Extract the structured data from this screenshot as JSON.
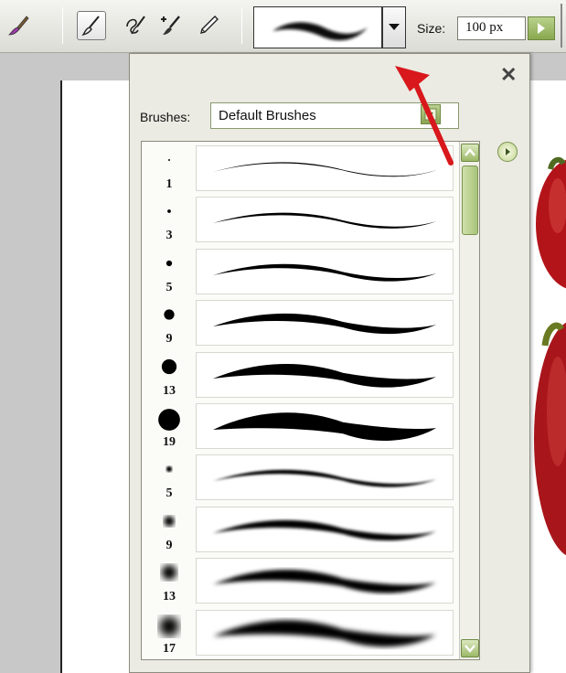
{
  "toolbar": {
    "tools": [
      {
        "icon": "brush-tool-icon",
        "active": false
      },
      {
        "icon": "brush-icon",
        "active": true
      },
      {
        "icon": "impressionist-brush-icon",
        "active": false
      },
      {
        "icon": "color-replacement-icon",
        "active": false
      },
      {
        "icon": "pencil-icon",
        "active": false
      }
    ],
    "size_label": "Size:",
    "size_value": "100 px"
  },
  "brush_picker": {
    "brushes_label": "Brushes:",
    "brush_set": "Default Brushes",
    "brushes": [
      {
        "size": "1",
        "hardness": "hard"
      },
      {
        "size": "3",
        "hardness": "hard"
      },
      {
        "size": "5",
        "hardness": "hard"
      },
      {
        "size": "9",
        "hardness": "hard"
      },
      {
        "size": "13",
        "hardness": "hard"
      },
      {
        "size": "19",
        "hardness": "hard"
      },
      {
        "size": "5",
        "hardness": "soft"
      },
      {
        "size": "9",
        "hardness": "soft"
      },
      {
        "size": "13",
        "hardness": "soft"
      },
      {
        "size": "17",
        "hardness": "soft"
      }
    ]
  },
  "colors": {
    "accent_green": "#9cb867",
    "annotation_red": "#d8181c"
  }
}
